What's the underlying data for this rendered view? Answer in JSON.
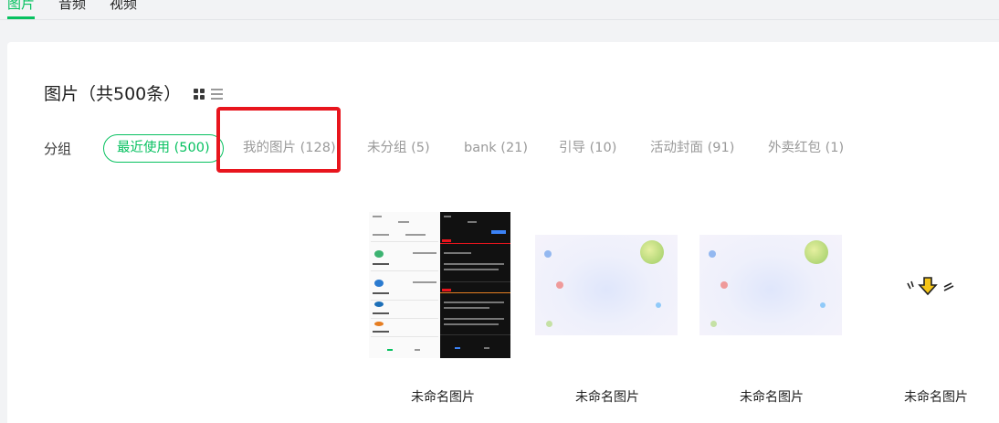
{
  "top_tabs": [
    {
      "label": "图片",
      "active": true
    },
    {
      "label": "音频",
      "active": false
    },
    {
      "label": "视频",
      "active": false
    }
  ],
  "header": {
    "title": "图片（共500条）",
    "view_modes": [
      "grid-icon",
      "list-icon"
    ]
  },
  "groups": {
    "label": "分组",
    "items": [
      {
        "label": "最近使用 (500)",
        "active": true
      },
      {
        "label": "我的图片 (128)",
        "active": false,
        "highlighted": true
      },
      {
        "label": "未分组 (5)",
        "active": false
      },
      {
        "label": "bank (21)",
        "active": false
      },
      {
        "label": "引导 (10)",
        "active": false
      },
      {
        "label": "活动封面 (91)",
        "active": false
      },
      {
        "label": "外卖红包 (1)",
        "active": false
      }
    ]
  },
  "images": [
    {
      "caption": "未命名图片",
      "kind": "phone-screenshot"
    },
    {
      "caption": "未命名图片",
      "kind": "planet-illustration"
    },
    {
      "caption": "未命名图片",
      "kind": "planet-illustration"
    },
    {
      "caption": "未命名图片",
      "kind": "arrow-sticker"
    }
  ],
  "colors": {
    "accent": "#07c160",
    "highlight": "#e8151d",
    "muted_text": "#9a9a9a",
    "background": "#f2f3f5"
  }
}
